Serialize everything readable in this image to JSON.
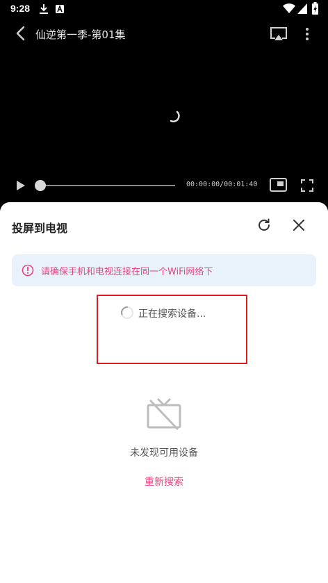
{
  "status_bar": {
    "time": "9:28",
    "icons": [
      "download-icon",
      "a-badge-icon",
      "wifi-icon",
      "signal-icon",
      "battery-charging-icon"
    ]
  },
  "video": {
    "title": "仙逆第一季-第01集",
    "current_time": "00:00:00",
    "duration": "00:01:40",
    "time_display": "00:00:00/00:01:40",
    "progress": 0
  },
  "sheet": {
    "title": "投屏到电视",
    "notice": "请确保手机和电视连接在同一个WiFi网络下",
    "searching_text": "正在搜索设备...",
    "empty_text": "未发现可用设备",
    "retry_label": "重新搜索"
  },
  "colors": {
    "accent": "#e8447f",
    "notice_bg": "#e9f2fb",
    "highlight_border": "#e01b1b"
  }
}
